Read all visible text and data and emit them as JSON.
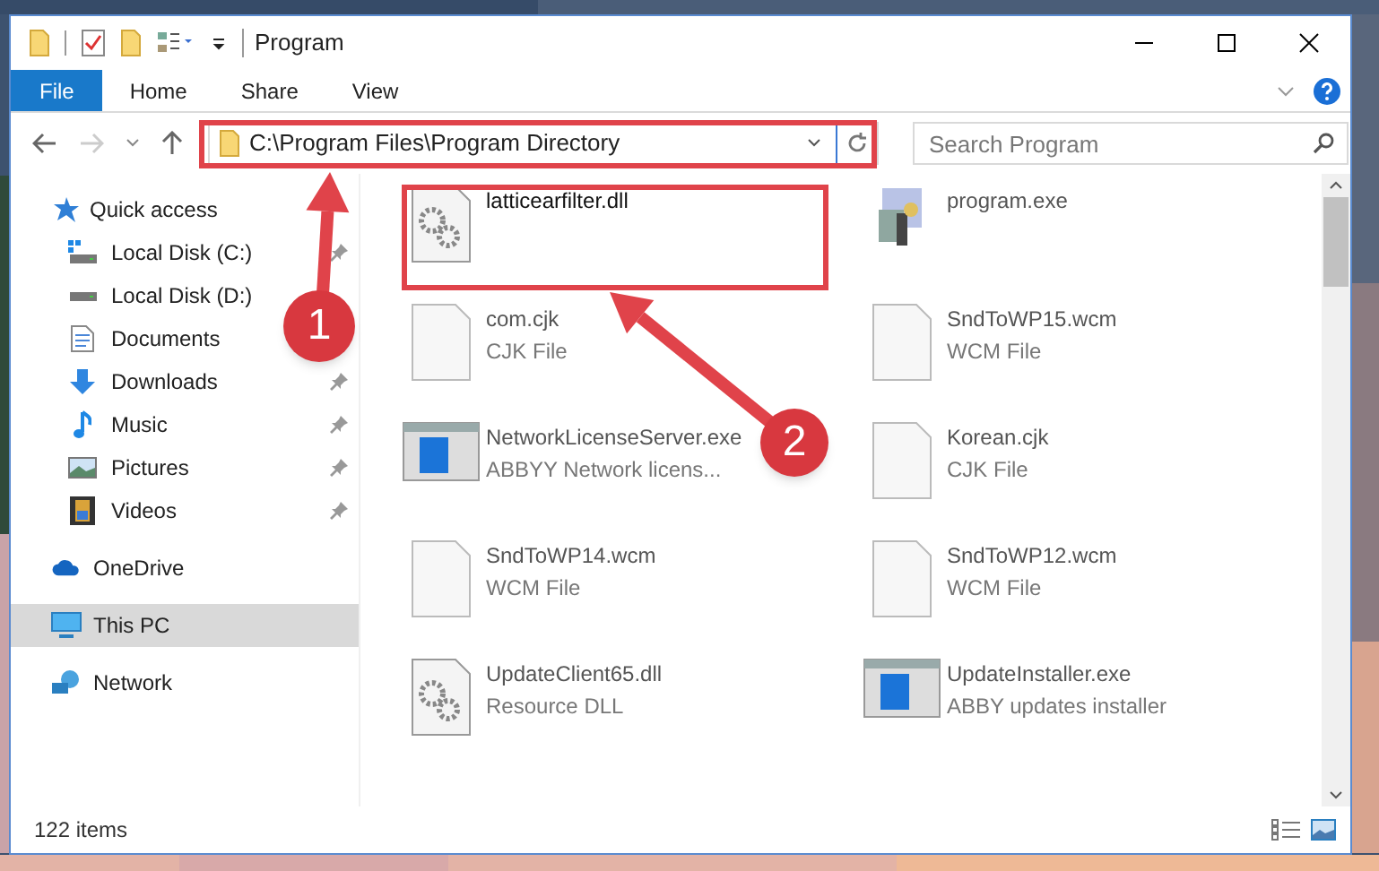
{
  "window": {
    "title": "Program"
  },
  "ribbon_tabs": [
    {
      "label": "File",
      "selected": true
    },
    {
      "label": "Home",
      "selected": false
    },
    {
      "label": "Share",
      "selected": false
    },
    {
      "label": "View",
      "selected": false
    }
  ],
  "address_bar": {
    "path": "C:\\Program Files\\Program Directory"
  },
  "search": {
    "placeholder": "Search Program"
  },
  "sidebar": {
    "items": [
      {
        "label": "Quick access",
        "selected": false,
        "children": [
          {
            "label": "Local Disk (C:)",
            "pinned": true
          },
          {
            "label": "Local Disk (D:)",
            "pinned": false
          },
          {
            "label": "Documents",
            "pinned": false
          },
          {
            "label": "Downloads",
            "pinned": true
          },
          {
            "label": "Music",
            "pinned": true
          },
          {
            "label": "Pictures",
            "pinned": true
          },
          {
            "label": "Videos",
            "pinned": true
          }
        ]
      },
      {
        "label": "OneDrive",
        "selected": false
      },
      {
        "label": "This PC",
        "selected": true
      },
      {
        "label": "Network",
        "selected": false
      }
    ]
  },
  "files": [
    {
      "name": "latticearfilter.dll",
      "kind": "dll"
    },
    {
      "name": "program.exe",
      "kind": "setup"
    },
    {
      "name": "com.cjk",
      "type": "CJK File",
      "kind": "blank"
    },
    {
      "name": "SndToWP15.wcm",
      "type": "WCM File",
      "kind": "blank"
    },
    {
      "name": "NetworkLicenseServer.exe",
      "type": "ABBYY Network licens...",
      "kind": "app"
    },
    {
      "name": "Korean.cjk",
      "type": "CJK File",
      "kind": "blank"
    },
    {
      "name": "SndToWP14.wcm",
      "type": "WCM File",
      "kind": "blank"
    },
    {
      "name": "SndToWP12.wcm",
      "type": "WCM File",
      "kind": "blank"
    },
    {
      "name": "UpdateClient65.dll",
      "type": "Resource DLL",
      "kind": "dll"
    },
    {
      "name": "UpdateInstaller.exe",
      "type": "ABBY updates installer",
      "kind": "app"
    }
  ],
  "status_bar": {
    "item_count": "122 items"
  },
  "annotations": [
    {
      "number": "1"
    },
    {
      "number": "2"
    }
  ]
}
